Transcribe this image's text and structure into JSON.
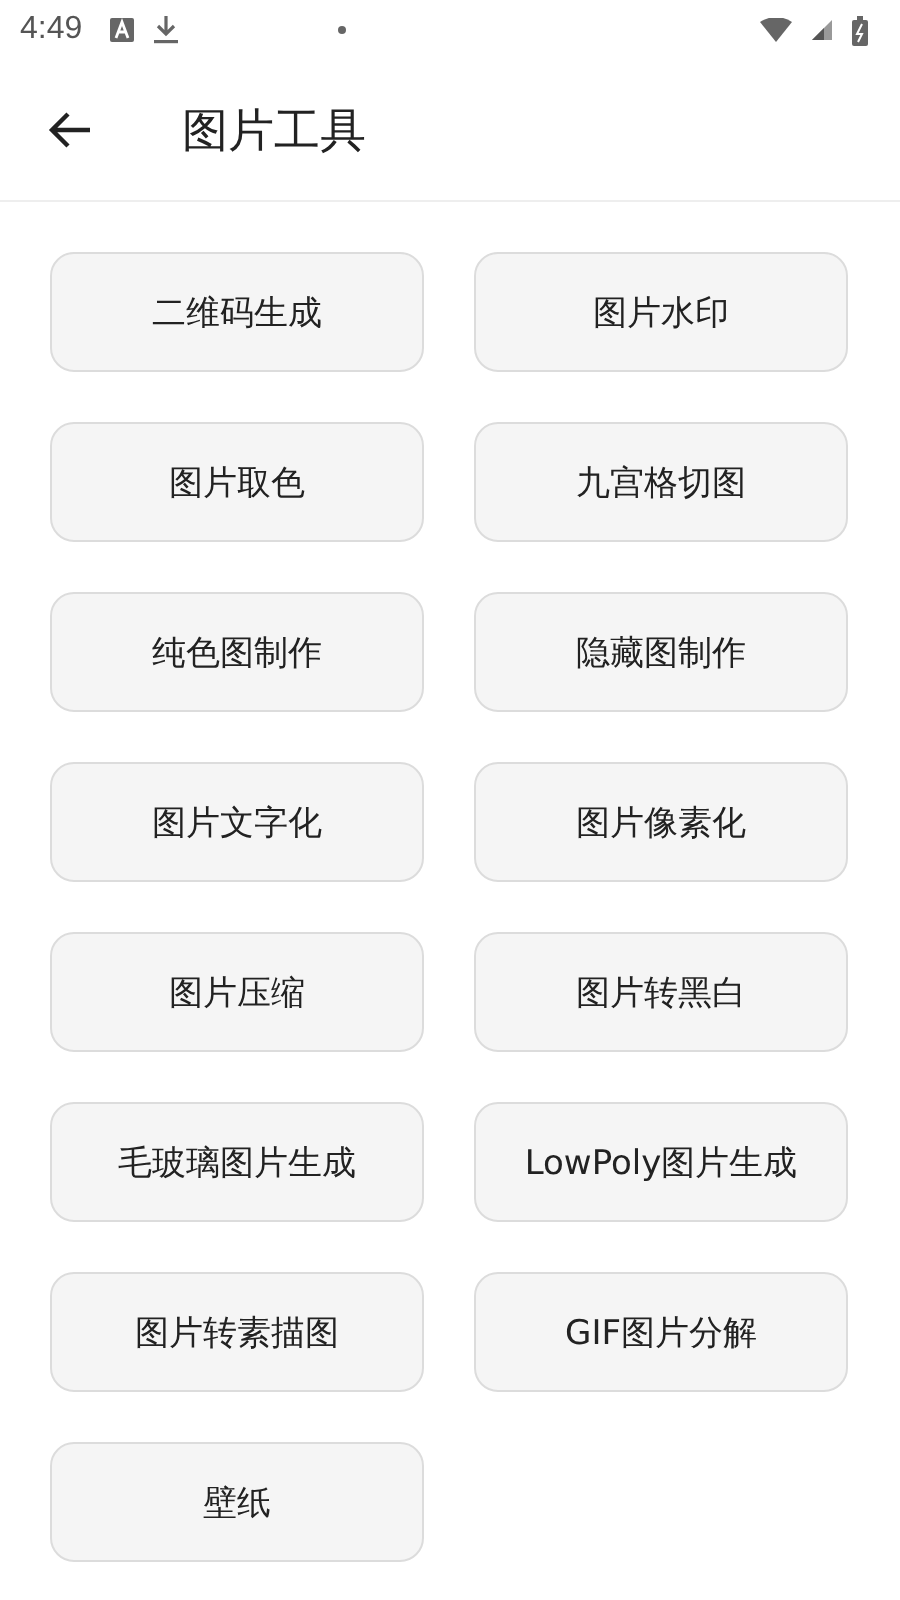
{
  "status_bar": {
    "time": "4:49"
  },
  "app_bar": {
    "title": "图片工具"
  },
  "tools": [
    {
      "label": "二维码生成"
    },
    {
      "label": "图片水印"
    },
    {
      "label": "图片取色"
    },
    {
      "label": "九宫格切图"
    },
    {
      "label": "纯色图制作"
    },
    {
      "label": "隐藏图制作"
    },
    {
      "label": "图片文字化"
    },
    {
      "label": "图片像素化"
    },
    {
      "label": "图片压缩"
    },
    {
      "label": "图片转黑白"
    },
    {
      "label": "毛玻璃图片生成"
    },
    {
      "label": "LowPoly图片生成"
    },
    {
      "label": "图片转素描图"
    },
    {
      "label": "GIF图片分解"
    },
    {
      "label": "壁纸"
    }
  ]
}
